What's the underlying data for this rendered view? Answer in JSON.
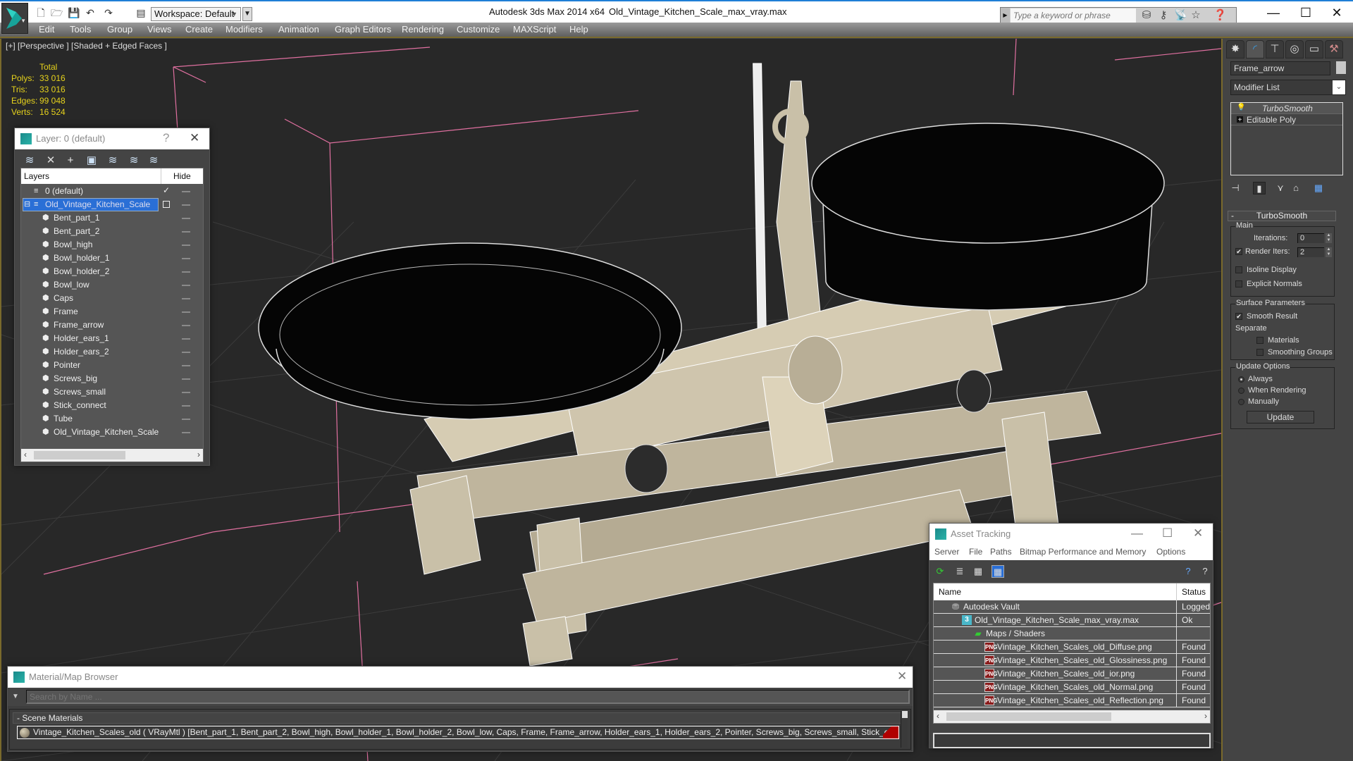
{
  "titlebar": {
    "workspace": "Workspace: Default",
    "app_title": "Autodesk 3ds Max  2014 x64",
    "doc_title": "Old_Vintage_Kitchen_Scale_max_vray.max",
    "search_placeholder": "Type a keyword or phrase",
    "quick_access": [
      "new-file-icon",
      "open-file-icon",
      "save-icon",
      "undo-icon",
      "redo-icon",
      "project-folder-icon"
    ],
    "search_tools": [
      "binoculars-icon",
      "key-icon",
      "satellite-icon",
      "star-icon",
      "help-icon"
    ],
    "window_buttons": [
      "minimize",
      "maximize",
      "close"
    ]
  },
  "menubar": {
    "items": [
      "Edit",
      "Tools",
      "Group",
      "Views",
      "Create",
      "Modifiers",
      "Animation",
      "Graph Editors",
      "Rendering",
      "Customize",
      "MAXScript",
      "Help"
    ]
  },
  "viewport": {
    "label": "[+] [Perspective ] [Shaded + Edged Faces ]",
    "stats": {
      "header": "Total",
      "rows": [
        {
          "label": "Polys:",
          "value": "33 016"
        },
        {
          "label": "Tris:",
          "value": "33 016"
        },
        {
          "label": "Edges:",
          "value": "99 048"
        },
        {
          "label": "Verts:",
          "value": "16 524"
        }
      ]
    }
  },
  "layer_dialog": {
    "title": "Layer: 0 (default)",
    "help": "?",
    "col_layers": "Layers",
    "col_hide": "Hide",
    "tools": [
      "create-layer-icon",
      "delete-layer-icon",
      "add-to-layer-icon",
      "select-objects-icon",
      "select-layer-icon",
      "highlight-layer-icon",
      "hide-all-icon"
    ],
    "default_layer": "0 (default)",
    "active_layer": "Old_Vintage_Kitchen_Scale",
    "objects": [
      "Bent_part_1",
      "Bent_part_2",
      "Bowl_high",
      "Bowl_holder_1",
      "Bowl_holder_2",
      "Bowl_low",
      "Caps",
      "Frame",
      "Frame_arrow",
      "Holder_ears_1",
      "Holder_ears_2",
      "Pointer",
      "Screws_big",
      "Screws_small",
      "Stick_connect",
      "Tube",
      "Old_Vintage_Kitchen_Scale"
    ]
  },
  "command_panel": {
    "tabs": [
      "create",
      "modify",
      "hierarchy",
      "motion",
      "display",
      "utilities"
    ],
    "object_name": "Frame_arrow",
    "object_color": "#c8c8c8",
    "modifier_list": "Modifier List",
    "stack": [
      "TurboSmooth",
      "Editable Poly"
    ],
    "turbosmooth": {
      "title": "TurboSmooth",
      "main": "Main",
      "iterations_label": "Iterations:",
      "iterations": "0",
      "render_iters_label": "Render Iters:",
      "render_iters": "2",
      "render_iters_checked": true,
      "isoline": "Isoline Display",
      "explicit_normals": "Explicit Normals",
      "surface_params": "Surface Parameters",
      "smooth_result": "Smooth Result",
      "separate": "Separate",
      "materials": "Materials",
      "smoothing_groups": "Smoothing Groups",
      "update_options": "Update Options",
      "always": "Always",
      "when_rendering": "When Rendering",
      "manually": "Manually",
      "update_btn": "Update"
    }
  },
  "asset_tracking": {
    "title": "Asset Tracking",
    "menu": [
      "Server",
      "File",
      "Paths",
      "Bitmap Performance and Memory",
      "Options"
    ],
    "col_name": "Name",
    "col_status": "Status",
    "rows": [
      {
        "name": "Autodesk Vault",
        "status": "Logged",
        "icon": "vault-icon",
        "level": 1
      },
      {
        "name": "Old_Vintage_Kitchen_Scale_max_vray.max",
        "status": "Ok",
        "icon": "max-file-icon",
        "level": 2
      },
      {
        "name": "Maps / Shaders",
        "status": "",
        "icon": "maps-icon",
        "level": 3
      },
      {
        "name": "Vintage_Kitchen_Scales_old_Diffuse.png",
        "status": "Found",
        "icon": "png-icon",
        "level": 4
      },
      {
        "name": "Vintage_Kitchen_Scales_old_Glossiness.png",
        "status": "Found",
        "icon": "png-icon",
        "level": 4
      },
      {
        "name": "Vintage_Kitchen_Scales_old_ior.png",
        "status": "Found",
        "icon": "png-icon",
        "level": 4
      },
      {
        "name": "Vintage_Kitchen_Scales_old_Normal.png",
        "status": "Found",
        "icon": "png-icon",
        "level": 4
      },
      {
        "name": "Vintage_Kitchen_Scales_old_Reflection.png",
        "status": "Found",
        "icon": "png-icon",
        "level": 4
      }
    ]
  },
  "material_browser": {
    "title": "Material/Map Browser",
    "search_placeholder": "Search by Name ...",
    "group": "- Scene Materials",
    "item": "Vintage_Kitchen_Scales_old  ( VRayMtl ) [Bent_part_1, Bent_part_2, Bowl_high, Bowl_holder_1, Bowl_holder_2, Bowl_low, Caps, Frame, Frame_arrow, Holder_ears_1, Holder_ears_2, Pointer, Screws_big, Screws_small, Stick_connect, Tube]"
  },
  "colors": {
    "accent_blue": "#2a6fd6",
    "stats_yellow": "#e6d21c",
    "viewport_border": "#7a6a2c",
    "grid_pink": "#e070a0"
  }
}
